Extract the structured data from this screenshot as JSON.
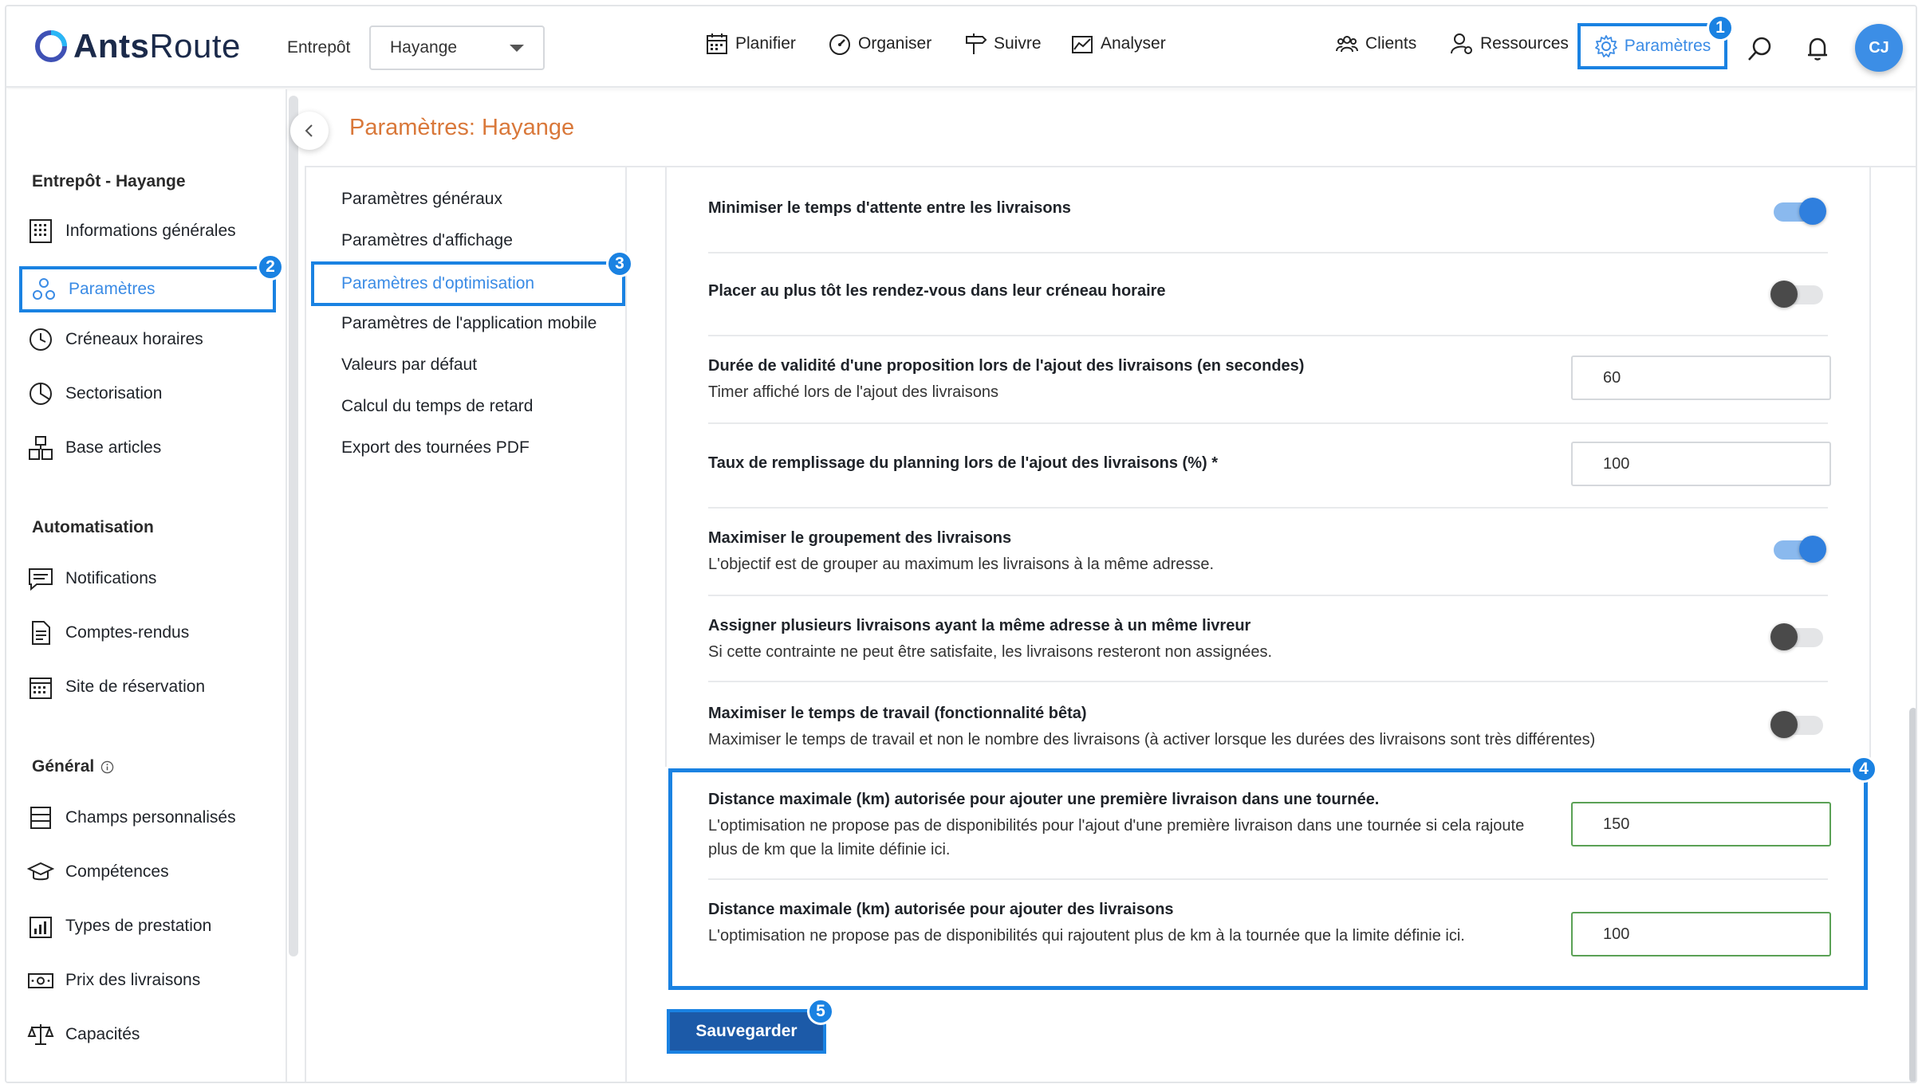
{
  "header": {
    "logo_text_bold": "Ants",
    "logo_text_light": "Route",
    "warehouse_label": "Entrepôt",
    "warehouse_value": "Hayange",
    "nav": {
      "planifier": "Planifier",
      "organiser": "Organiser",
      "suivre": "Suivre",
      "analyser": "Analyser",
      "clients": "Clients",
      "ressources": "Ressources",
      "parametres": "Paramètres"
    },
    "avatar_initials": "CJ"
  },
  "badges": [
    "1",
    "2",
    "3",
    "4",
    "5"
  ],
  "sidebar": {
    "section_warehouse": "Entrepôt - Hayange",
    "items_warehouse": [
      {
        "label": "Informations générales",
        "icon": "building-icon"
      },
      {
        "label": "Paramètres",
        "icon": "settings-icon"
      },
      {
        "label": "Créneaux horaires",
        "icon": "clock-icon"
      },
      {
        "label": "Sectorisation",
        "icon": "pie-icon"
      },
      {
        "label": "Base articles",
        "icon": "boxes-icon"
      }
    ],
    "section_automation": "Automatisation",
    "items_automation": [
      {
        "label": "Notifications",
        "icon": "message-icon"
      },
      {
        "label": "Comptes-rendus",
        "icon": "document-icon"
      },
      {
        "label": "Site de réservation",
        "icon": "calendar-icon"
      }
    ],
    "section_general": "Général",
    "items_general": [
      {
        "label": "Champs personnalisés",
        "icon": "list-icon"
      },
      {
        "label": "Compétences",
        "icon": "graduation-icon"
      },
      {
        "label": "Types de prestation",
        "icon": "chart-icon"
      },
      {
        "label": "Prix des livraisons",
        "icon": "money-icon"
      },
      {
        "label": "Capacités",
        "icon": "scale-icon"
      }
    ]
  },
  "page": {
    "title": "Paramètres: Hayange"
  },
  "submenu": [
    "Paramètres généraux",
    "Paramètres d'affichage",
    "Paramètres d'optimisation",
    "Paramètres de l'application mobile",
    "Valeurs par défaut",
    "Calcul du temps de retard",
    "Export des tournées PDF"
  ],
  "settings": [
    {
      "label": "Minimiser le temps d'attente entre les livraisons",
      "sub": "",
      "type": "toggle",
      "on": true
    },
    {
      "label": "Placer au plus tôt les rendez-vous dans leur créneau horaire",
      "sub": "",
      "type": "toggle",
      "on": false
    },
    {
      "label": "Durée de validité d'une proposition lors de l'ajout des livraisons (en secondes)",
      "sub": "Timer affiché lors de l'ajout des livraisons",
      "type": "input",
      "value": "60"
    },
    {
      "label": "Taux de remplissage du planning lors de l'ajout des livraisons (%) *",
      "sub": "",
      "type": "input",
      "value": "100"
    },
    {
      "label": "Maximiser le groupement des livraisons",
      "sub": "L'objectif est de grouper au maximum les livraisons à la même adresse.",
      "type": "toggle",
      "on": true
    },
    {
      "label": "Assigner plusieurs livraisons ayant la même adresse à un même livreur",
      "sub": "Si cette contrainte ne peut être satisfaite, les livraisons resteront non assignées.",
      "type": "toggle",
      "on": false
    },
    {
      "label": "Maximiser le temps de travail (fonctionnalité bêta)",
      "sub": "Maximiser le temps de travail et non le nombre des livraisons (à activer lorsque les durées des livraisons sont très différentes)",
      "type": "toggle",
      "on": false
    },
    {
      "label": "Distance maximale (km) autorisée pour ajouter une première livraison dans une tournée.",
      "sub": "L'optimisation ne propose pas de disponibilités pour l'ajout d'une première livraison dans une tournée si cela rajoute plus de km que la limite définie ici.",
      "type": "input",
      "value": "150"
    },
    {
      "label": "Distance maximale (km) autorisée pour ajouter des livraisons",
      "sub": "L'optimisation ne propose pas de disponibilités qui rajoutent plus de km à la tournée que la limite définie ici.",
      "type": "input",
      "value": "100"
    }
  ],
  "save_button": "Sauvegarder",
  "colors": {
    "accent": "#1a82e2",
    "title_orange": "#d9783a",
    "save_bg": "#1c5aa8"
  }
}
